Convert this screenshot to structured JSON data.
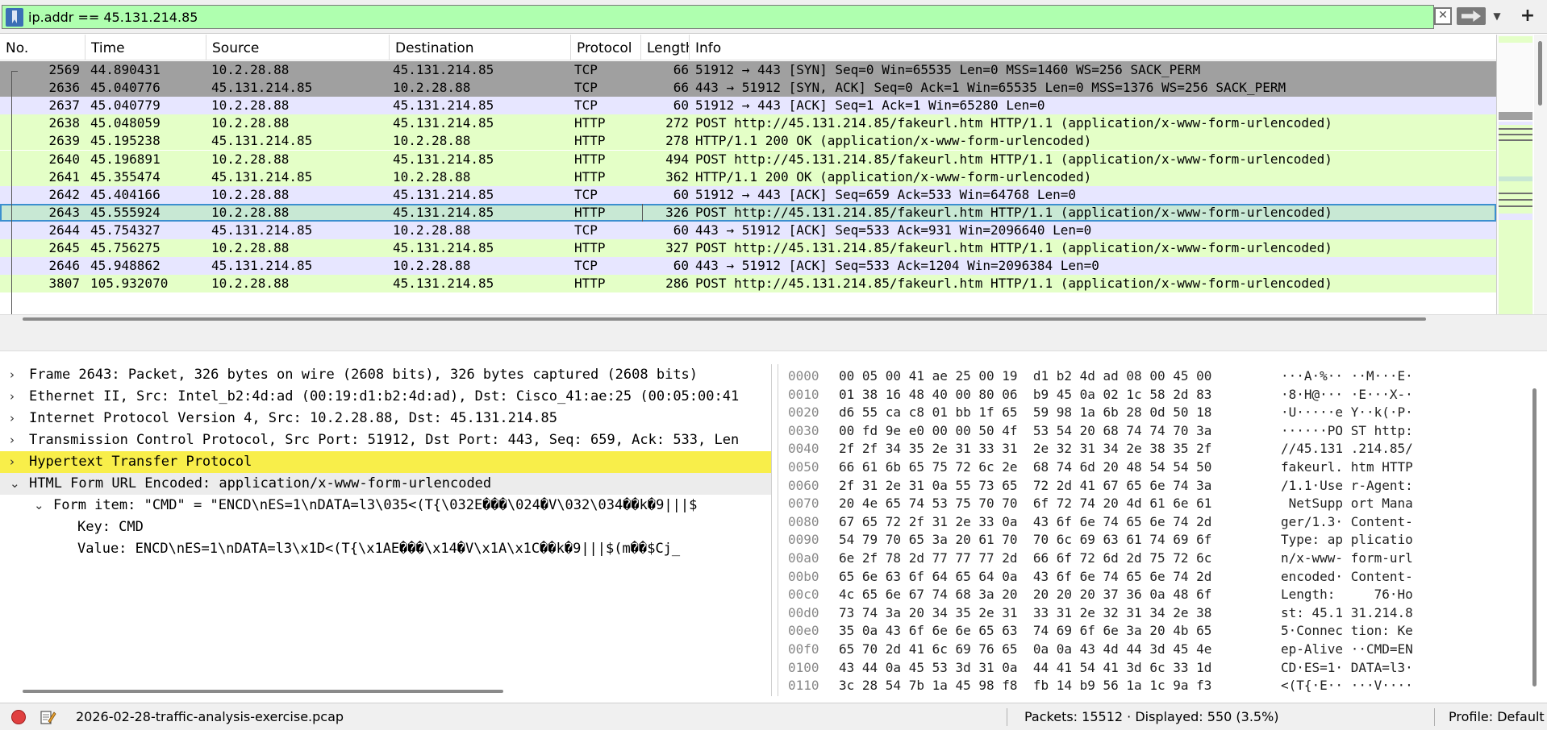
{
  "filter": {
    "value": "ip.addr == 45.131.214.85"
  },
  "packet_list": {
    "columns": [
      "No.",
      "Time",
      "Source",
      "Destination",
      "Protocol",
      "Length",
      "Info"
    ],
    "rows": [
      {
        "no": "2569",
        "time": "44.890431",
        "src": "10.2.28.88",
        "dst": "45.131.214.85",
        "proto": "TCP",
        "len": "66",
        "info": "51912 → 443 [SYN] Seq=0 Win=65535 Len=0 MSS=1460 WS=256 SACK_PERM",
        "style": "syn"
      },
      {
        "no": "2636",
        "time": "45.040776",
        "src": "45.131.214.85",
        "dst": "10.2.28.88",
        "proto": "TCP",
        "len": "66",
        "info": "443 → 51912 [SYN, ACK] Seq=0 Ack=1 Win=65535 Len=0 MSS=1376 WS=256 SACK_PERM",
        "style": "syn"
      },
      {
        "no": "2637",
        "time": "45.040779",
        "src": "10.2.28.88",
        "dst": "45.131.214.85",
        "proto": "TCP",
        "len": "60",
        "info": "51912 → 443 [ACK] Seq=1 Ack=1 Win=65280 Len=0",
        "style": "tcp"
      },
      {
        "no": "2638",
        "time": "45.048059",
        "src": "10.2.28.88",
        "dst": "45.131.214.85",
        "proto": "HTTP",
        "len": "272",
        "info": "POST http://45.131.214.85/fakeurl.htm HTTP/1.1  (application/x-www-form-urlencoded)",
        "style": "http"
      },
      {
        "no": "2639",
        "time": "45.195238",
        "src": "45.131.214.85",
        "dst": "10.2.28.88",
        "proto": "HTTP",
        "len": "278",
        "info": "HTTP/1.1 200 OK  (application/x-www-form-urlencoded)",
        "style": "http"
      },
      {
        "no": "2640",
        "time": "45.196891",
        "src": "10.2.28.88",
        "dst": "45.131.214.85",
        "proto": "HTTP",
        "len": "494",
        "info": "POST http://45.131.214.85/fakeurl.htm HTTP/1.1  (application/x-www-form-urlencoded)",
        "style": "http"
      },
      {
        "no": "2641",
        "time": "45.355474",
        "src": "45.131.214.85",
        "dst": "10.2.28.88",
        "proto": "HTTP",
        "len": "362",
        "info": "HTTP/1.1 200 OK  (application/x-www-form-urlencoded)",
        "style": "http"
      },
      {
        "no": "2642",
        "time": "45.404166",
        "src": "10.2.28.88",
        "dst": "45.131.214.85",
        "proto": "TCP",
        "len": "60",
        "info": "51912 → 443 [ACK] Seq=659 Ack=533 Win=64768 Len=0",
        "style": "tcp"
      },
      {
        "no": "2643",
        "time": "45.555924",
        "src": "10.2.28.88",
        "dst": "45.131.214.85",
        "proto": "HTTP",
        "len": "326",
        "info": "POST http://45.131.214.85/fakeurl.htm HTTP/1.1  (application/x-www-form-urlencoded)",
        "style": "selected"
      },
      {
        "no": "2644",
        "time": "45.754327",
        "src": "45.131.214.85",
        "dst": "10.2.28.88",
        "proto": "TCP",
        "len": "60",
        "info": "443 → 51912 [ACK] Seq=533 Ack=931 Win=2096640 Len=0",
        "style": "tcp"
      },
      {
        "no": "2645",
        "time": "45.756275",
        "src": "10.2.28.88",
        "dst": "45.131.214.85",
        "proto": "HTTP",
        "len": "327",
        "info": "POST http://45.131.214.85/fakeurl.htm HTTP/1.1  (application/x-www-form-urlencoded)",
        "style": "http"
      },
      {
        "no": "2646",
        "time": "45.948862",
        "src": "45.131.214.85",
        "dst": "10.2.28.88",
        "proto": "TCP",
        "len": "60",
        "info": "443 → 51912 [ACK] Seq=533 Ack=1204 Win=2096384 Len=0",
        "style": "tcp"
      },
      {
        "no": "3807",
        "time": "105.932070",
        "src": "10.2.28.88",
        "dst": "45.131.214.85",
        "proto": "HTTP",
        "len": "286",
        "info": "POST http://45.131.214.85/fakeurl.htm HTTP/1.1  (application/x-www-form-urlencoded)",
        "style": "http"
      }
    ]
  },
  "details": [
    {
      "text": "Frame 2643: Packet, 326 bytes on wire (2608 bits), 326 bytes captured (2608 bits)",
      "arrow": "›",
      "level": 0,
      "style": ""
    },
    {
      "text": "Ethernet II, Src: Intel_b2:4d:ad (00:19:d1:b2:4d:ad), Dst: Cisco_41:ae:25 (00:05:00:41",
      "arrow": "›",
      "level": 0,
      "style": ""
    },
    {
      "text": "Internet Protocol Version 4, Src: 10.2.28.88, Dst: 45.131.214.85",
      "arrow": "›",
      "level": 0,
      "style": ""
    },
    {
      "text": "Transmission Control Protocol, Src Port: 51912, Dst Port: 443, Seq: 659, Ack: 533, Len",
      "arrow": "›",
      "level": 0,
      "style": ""
    },
    {
      "text": "Hypertext Transfer Protocol",
      "arrow": "›",
      "level": 0,
      "style": "hl"
    },
    {
      "text": "HTML Form URL Encoded: application/x-www-form-urlencoded",
      "arrow": "⌄",
      "level": 0,
      "style": "open"
    },
    {
      "text": "Form item: \"CMD\" = \"ENCD\\nES=1\\nDATA=l3\\035<(T{\\032E���\\024�V\\032\\034��k�9|||$",
      "arrow": "⌄",
      "level": 1,
      "style": ""
    },
    {
      "text": "Key: CMD",
      "arrow": "",
      "level": 2,
      "style": ""
    },
    {
      "text": "Value: ENCD\\nES=1\\nDATA=l3\\x1D<(T{\\x1AE���\\x14�V\\x1A\\x1C��k�9|||$(m��$Cj_",
      "arrow": "",
      "level": 2,
      "style": ""
    }
  ],
  "bytes": [
    {
      "off": "0000",
      "hex": "00 05 00 41 ae 25 00 19  d1 b2 4d ad 08 00 45 00",
      "ascii": "···A·%·· ··M···E·"
    },
    {
      "off": "0010",
      "hex": "01 38 16 48 40 00 80 06  b9 45 0a 02 1c 58 2d 83",
      "ascii": "·8·H@··· ·E···X-·"
    },
    {
      "off": "0020",
      "hex": "d6 55 ca c8 01 bb 1f 65  59 98 1a 6b 28 0d 50 18",
      "ascii": "·U·····e Y··k(·P·"
    },
    {
      "off": "0030",
      "hex": "00 fd 9e e0 00 00 50 4f  53 54 20 68 74 74 70 3a",
      "ascii": "······PO ST http:"
    },
    {
      "off": "0040",
      "hex": "2f 2f 34 35 2e 31 33 31  2e 32 31 34 2e 38 35 2f",
      "ascii": "//45.131 .214.85/"
    },
    {
      "off": "0050",
      "hex": "66 61 6b 65 75 72 6c 2e  68 74 6d 20 48 54 54 50",
      "ascii": "fakeurl. htm HTTP"
    },
    {
      "off": "0060",
      "hex": "2f 31 2e 31 0a 55 73 65  72 2d 41 67 65 6e 74 3a",
      "ascii": "/1.1·Use r-Agent:"
    },
    {
      "off": "0070",
      "hex": "20 4e 65 74 53 75 70 70  6f 72 74 20 4d 61 6e 61",
      "ascii": " NetSupp ort Mana"
    },
    {
      "off": "0080",
      "hex": "67 65 72 2f 31 2e 33 0a  43 6f 6e 74 65 6e 74 2d",
      "ascii": "ger/1.3· Content-"
    },
    {
      "off": "0090",
      "hex": "54 79 70 65 3a 20 61 70  70 6c 69 63 61 74 69 6f",
      "ascii": "Type: ap plicatio"
    },
    {
      "off": "00a0",
      "hex": "6e 2f 78 2d 77 77 77 2d  66 6f 72 6d 2d 75 72 6c",
      "ascii": "n/x-www- form-url"
    },
    {
      "off": "00b0",
      "hex": "65 6e 63 6f 64 65 64 0a  43 6f 6e 74 65 6e 74 2d",
      "ascii": "encoded· Content-"
    },
    {
      "off": "00c0",
      "hex": "4c 65 6e 67 74 68 3a 20  20 20 20 37 36 0a 48 6f",
      "ascii": "Length:     76·Ho"
    },
    {
      "off": "00d0",
      "hex": "73 74 3a 20 34 35 2e 31  33 31 2e 32 31 34 2e 38",
      "ascii": "st: 45.1 31.214.8"
    },
    {
      "off": "00e0",
      "hex": "35 0a 43 6f 6e 6e 65 63  74 69 6f 6e 3a 20 4b 65",
      "ascii": "5·Connec tion: Ke"
    },
    {
      "off": "00f0",
      "hex": "65 70 2d 41 6c 69 76 65  0a 0a 43 4d 44 3d 45 4e",
      "ascii": "ep-Alive ··CMD=EN"
    },
    {
      "off": "0100",
      "hex": "43 44 0a 45 53 3d 31 0a  44 41 54 41 3d 6c 33 1d",
      "ascii": "CD·ES=1· DATA=l3·"
    },
    {
      "off": "0110",
      "hex": "3c 28 54 7b 1a 45 98 f8  fb 14 b9 56 1a 1c 9a f3",
      "ascii": "<(T{·E·· ···V····"
    }
  ],
  "status": {
    "file": "2026-02-28-traffic-analysis-exercise.pcap",
    "packets": "Packets: 15512 · Displayed: 550 (3.5%)",
    "profile": "Profile: Default"
  },
  "colors": {
    "filter_valid": "#afffaf",
    "row_syn": "#a0a0a0",
    "row_tcp": "#e7e6ff",
    "row_http": "#e4ffc7",
    "row_selected": "#c8e8d4",
    "tree_highlight": "#f8ee4a"
  }
}
